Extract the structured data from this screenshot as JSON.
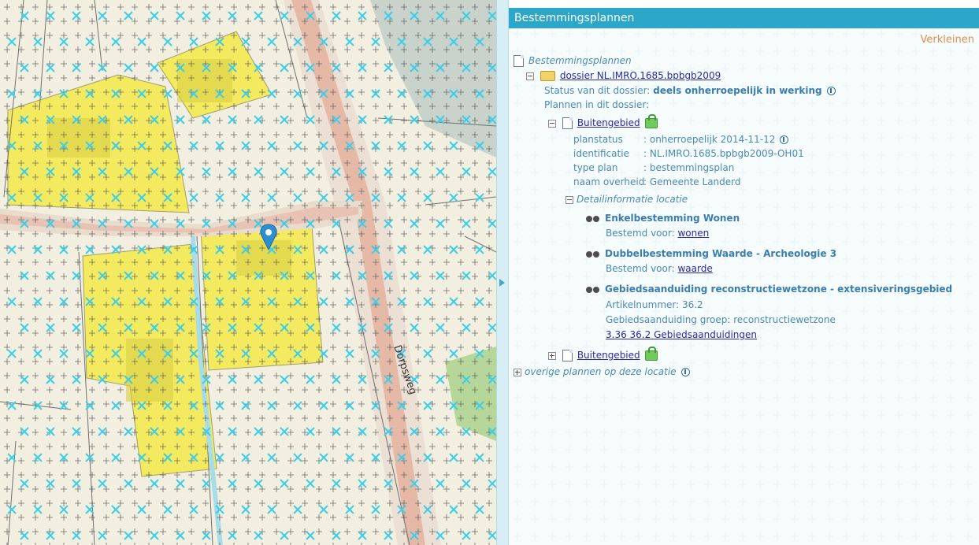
{
  "map": {
    "street_label": "Dorpsweg"
  },
  "panel": {
    "title": "Bestemmingsplannen",
    "collapse_label": "Verkleinen",
    "root_label": "Bestemmingsplannen",
    "dossier": {
      "link": "dossier NL.IMRO.1685.bpbgb2009",
      "status_label": "Status van dit dossier:",
      "status_value": "deels onherroepelijk in werking",
      "plans_label": "Plannen in dit dossier:"
    },
    "plan1": {
      "name": "Buitengebied",
      "fields": [
        {
          "key": "planstatus",
          "value": ": onherroepelijk 2014-11-12"
        },
        {
          "key": "identificatie",
          "value": ": NL.IMRO.1685.bpbgb2009-OH01"
        },
        {
          "key": "type plan",
          "value": ": bestemmingsplan"
        },
        {
          "key": "naam overheid",
          "value": ": Gemeente Landerd"
        }
      ],
      "detail_label": "Detailinformatie locatie",
      "details": [
        {
          "title": "Enkelbestemming Wonen",
          "sub_label": "Bestemd voor:",
          "sub_link": "wonen"
        },
        {
          "title": "Dubbelbestemming Waarde - Archeologie 3",
          "sub_label": "Bestemd voor:",
          "sub_link": "waarde"
        },
        {
          "title": "Gebiedsaanduiding reconstructiewetzone - extensiveringsgebied",
          "line1": "Artikelnummer: 36.2",
          "line2": "Gebiedsaanduiding groep: reconstructiewetzone",
          "link": "3.36 36.2 Gebiedsaanduidingen"
        }
      ]
    },
    "plan2": {
      "name": "Buitengebied"
    },
    "other_label": "overige plannen op deze locatie"
  },
  "colors": {
    "header_bg": "#2da7c9",
    "collapse_link": "#e08b4f",
    "zone_yellow": "#f5ea5a",
    "marker": "#2d8fd0",
    "cross_cyan": "#3dcde8"
  }
}
